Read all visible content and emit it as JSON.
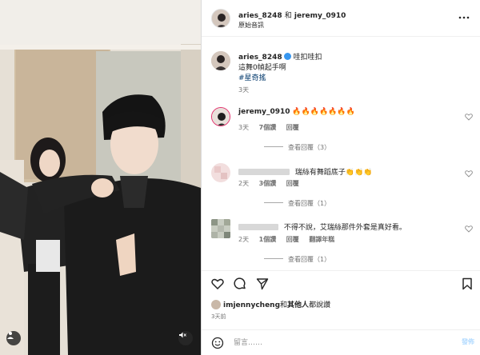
{
  "post": {
    "header": {
      "user1": "aries_8248",
      "conjunction": "和",
      "user2": "jeremy_0910",
      "audio": "原始音訊"
    },
    "caption": {
      "username": "aries_8248",
      "line1": "哇扣哇扣",
      "line2": "這舞0幀起手啊",
      "hashtag": "#星奇搖",
      "time": "3天"
    },
    "comments": [
      {
        "username": "jeremy_0910",
        "text": "🔥🔥🔥🔥🔥🔥🔥",
        "time": "3天",
        "likes": "7個讚",
        "reply": "回覆",
        "view_replies": "查看回覆（3）"
      },
      {
        "username": "",
        "text": "瑞絲有舞蹈底子👏👏👏",
        "time": "2天",
        "likes": "3個讚",
        "reply": "回覆",
        "view_replies": "查看回覆（1）"
      },
      {
        "username": "",
        "text": "不得不說，艾瑞絲那件外套是真好看。",
        "time": "2天",
        "likes": "1個讚",
        "reply": "回覆",
        "translate": "翻譯年糕",
        "view_replies": "查看回覆（1）"
      }
    ],
    "likes_line": {
      "user": "imjennycheng",
      "and": "和",
      "others": "其他人",
      "suffix": "都說讚"
    },
    "posted_time": "3天前",
    "composer": {
      "placeholder": "留言……",
      "post": "發佈"
    },
    "colors": {
      "link": "#00376b",
      "verified": "#3897f0",
      "muted": "#737373"
    },
    "icons": [
      "heart-icon",
      "comment-icon",
      "share-icon",
      "bookmark-icon",
      "emoji-icon",
      "more-icon",
      "mute-icon",
      "tag-user-icon"
    ]
  }
}
